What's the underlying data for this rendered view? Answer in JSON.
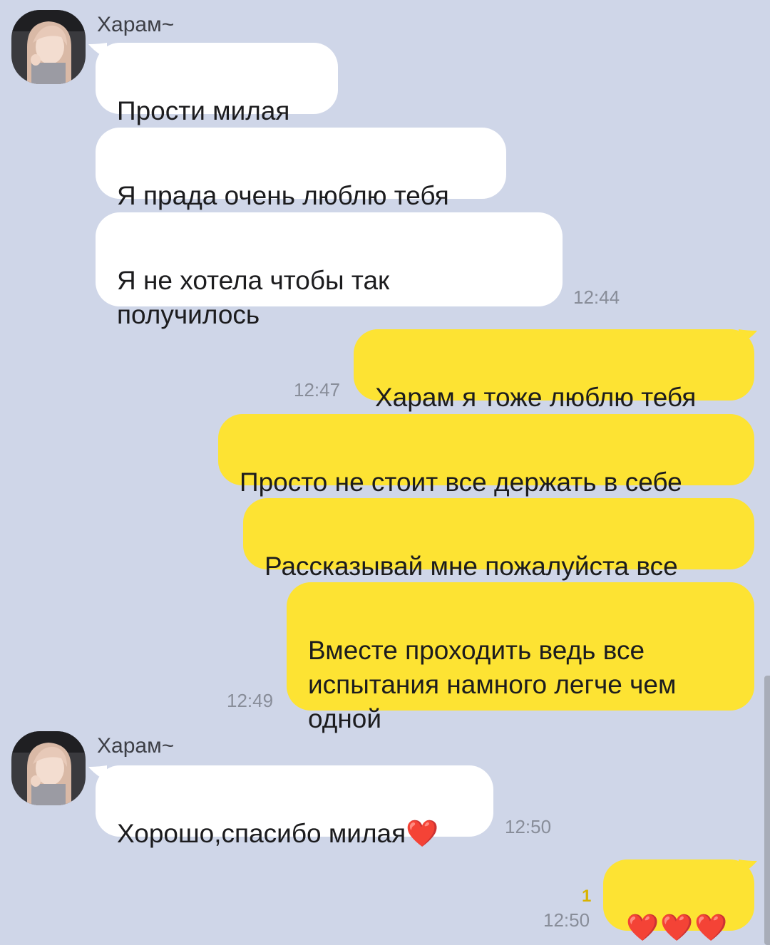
{
  "contact": {
    "name": "Харам~"
  },
  "messages": [
    {
      "text": "Прости милая"
    },
    {
      "text": "Я прада очень люблю тебя"
    },
    {
      "text": "Я не хотела чтобы так\nполучилось",
      "time": "12:44"
    },
    {
      "text": "Харам я тоже люблю тебя",
      "time": "12:47"
    },
    {
      "text": "Просто не стоит все держать в себе"
    },
    {
      "text": "Рассказывай мне пожалуйста все"
    },
    {
      "text": "Вместе проходить ведь все\nиспытания намного легче чем\nодной",
      "time": "12:49"
    },
    {
      "text": "Хорошо,спасибо милая❤️",
      "time": "12:50"
    },
    {
      "text": "❤️❤️❤️",
      "time": "12:50",
      "unread": "1"
    }
  ],
  "colors": {
    "background": "#cfd6e8",
    "incoming_bubble": "#ffffff",
    "outgoing_bubble": "#fde333"
  }
}
